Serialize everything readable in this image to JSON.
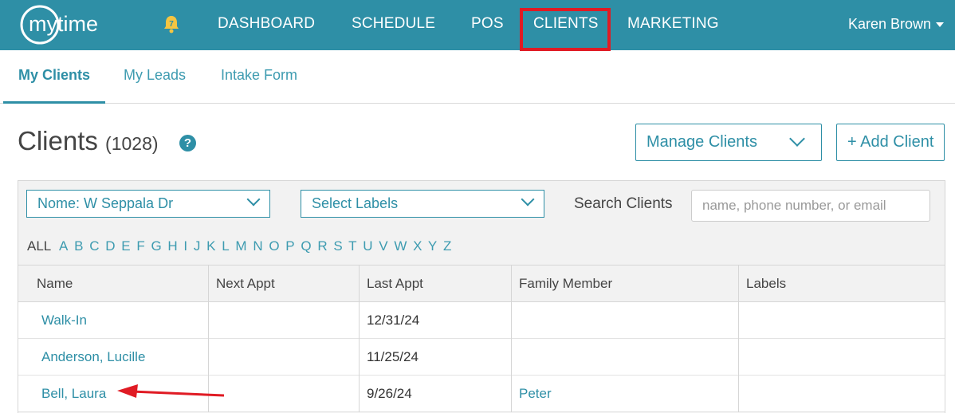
{
  "header": {
    "logo_text": "mytime",
    "notification_count": "7",
    "nav": [
      {
        "label": "DASHBOARD"
      },
      {
        "label": "SCHEDULE"
      },
      {
        "label": "POS"
      },
      {
        "label": "CLIENTS"
      },
      {
        "label": "MARKETING"
      }
    ],
    "user_name": "Karen Brown"
  },
  "subnav": {
    "tabs": [
      {
        "label": "My Clients",
        "active": true
      },
      {
        "label": "My Leads"
      },
      {
        "label": "Intake Form"
      }
    ]
  },
  "page": {
    "title": "Clients",
    "count": "(1028)",
    "help": "?",
    "manage_button": "Manage Clients",
    "add_button": "+ Add Client"
  },
  "filters": {
    "location": "Nome: W Seppala Dr",
    "labels": "Select Labels",
    "search_label": "Search Clients",
    "search_placeholder": "name, phone number, or email",
    "alpha_all": "ALL",
    "letters": [
      "A",
      "B",
      "C",
      "D",
      "E",
      "F",
      "G",
      "H",
      "I",
      "J",
      "K",
      "L",
      "M",
      "N",
      "O",
      "P",
      "Q",
      "R",
      "S",
      "T",
      "U",
      "V",
      "W",
      "X",
      "Y",
      "Z"
    ]
  },
  "table": {
    "columns": [
      "Name",
      "Next Appt",
      "Last Appt",
      "Family Member",
      "Labels"
    ],
    "rows": [
      {
        "name": "Walk-In",
        "next": "",
        "last": "12/31/24",
        "family": "",
        "labels": ""
      },
      {
        "name": "Anderson, Lucille",
        "next": "",
        "last": "11/25/24",
        "family": "",
        "labels": ""
      },
      {
        "name": "Bell, Laura",
        "next": "",
        "last": "9/26/24",
        "family": "Peter",
        "labels": ""
      }
    ]
  },
  "colors": {
    "brand": "#2e8fa6",
    "highlight": "#e01b24"
  }
}
